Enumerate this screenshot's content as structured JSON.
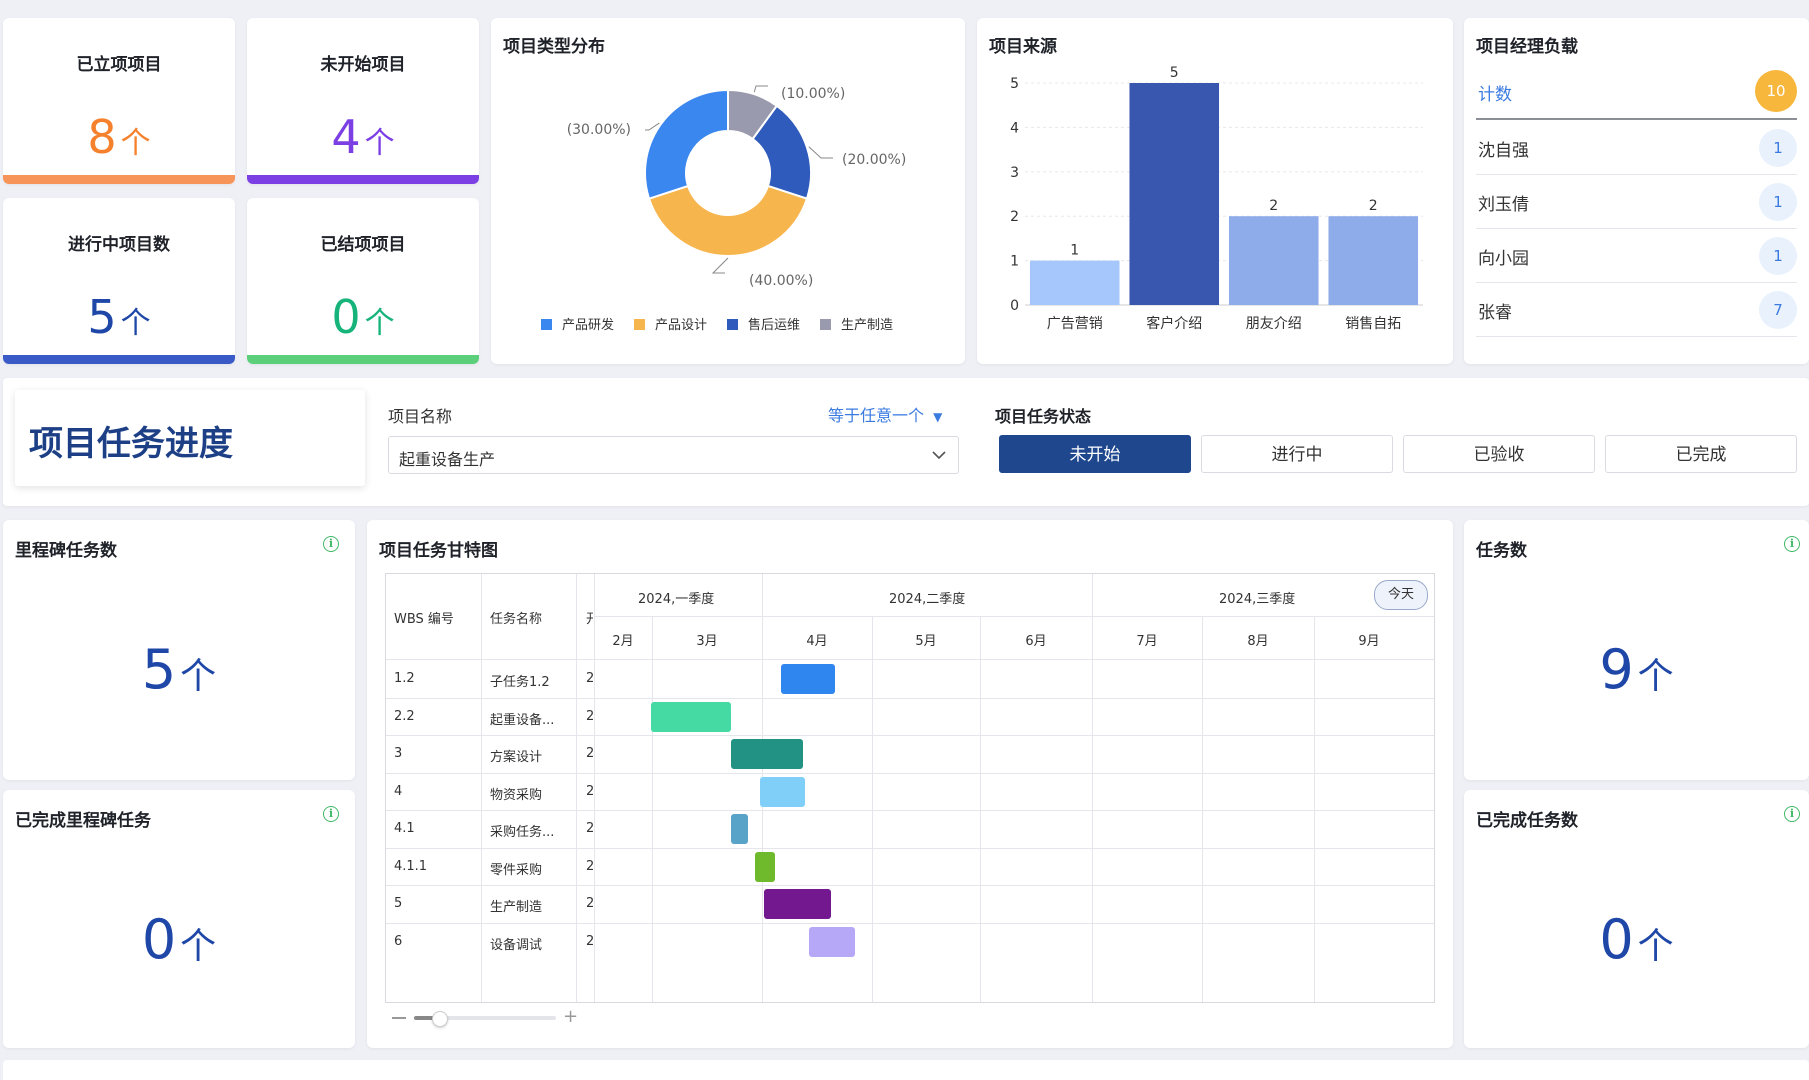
{
  "stats": [
    {
      "title": "已立项项目",
      "value": "8",
      "unit": "个",
      "color": "#f5812d",
      "bar": "#f6945a"
    },
    {
      "title": "未开始项目",
      "value": "4",
      "unit": "个",
      "color": "#7b3fe4",
      "bar": "#7b3fe4"
    },
    {
      "title": "进行中项目数",
      "value": "5",
      "unit": "个",
      "color": "#1e47a8",
      "bar": "#3a5bc7"
    },
    {
      "title": "已结项项目",
      "value": "0",
      "unit": "个",
      "color": "#16b37a",
      "bar": "#5ccf7a"
    }
  ],
  "type_dist": {
    "title": "项目类型分布",
    "chart_data": {
      "type": "pie",
      "labels": [
        "产品研发",
        "产品设计",
        "售后运维",
        "生产制造"
      ],
      "values": [
        30,
        40,
        20,
        10
      ],
      "value_labels": [
        "(30.00%)",
        "(40.00%)",
        "(20.00%)",
        "(10.00%)"
      ],
      "colors": [
        "#3b87f0",
        "#f7b54d",
        "#2f5bbd",
        "#9a9aae"
      ]
    }
  },
  "source": {
    "title": "项目来源",
    "chart_data": {
      "type": "bar",
      "categories": [
        "广告营销",
        "客户介绍",
        "朋友介绍",
        "销售自拓"
      ],
      "values": [
        1,
        5,
        2,
        2
      ],
      "ylim": [
        0,
        5
      ],
      "yticks": [
        "0",
        "1",
        "2",
        "3",
        "4",
        "5"
      ],
      "colors": [
        "#a6c7fb",
        "#3a57b0",
        "#8eabea",
        "#8eabea"
      ]
    }
  },
  "managers": {
    "title": "项目经理负载",
    "header_label": "计数",
    "header_value": "10",
    "rows": [
      {
        "name": "沈自强",
        "count": "1"
      },
      {
        "name": "刘玉倩",
        "count": "1"
      },
      {
        "name": "向小园",
        "count": "1"
      },
      {
        "name": "张睿",
        "count": "7"
      }
    ]
  },
  "filter": {
    "page_title": "项目任务进度",
    "project_label": "项目名称",
    "operator": "等于任意一个",
    "project_value": "起重设备生产",
    "status_label": "项目任务状态",
    "status_options": [
      "未开始",
      "进行中",
      "已验收",
      "已完成"
    ],
    "active_status": "未开始"
  },
  "kpis": {
    "milestone_title": "里程碑任务数",
    "milestone_value": "5",
    "milestone_done_title": "已完成里程碑任务",
    "milestone_done_value": "0",
    "task_title": "任务数",
    "task_value": "9",
    "task_done_title": "已完成任务数",
    "task_done_value": "0",
    "unit": "个"
  },
  "gantt": {
    "title": "项目任务甘特图",
    "col_wbs": "WBS 编号",
    "col_name": "任务名称",
    "col_start_partial": "开",
    "today_label": "今天",
    "quarters": [
      "2024,一季度",
      "2024,二季度",
      "2024,三季度"
    ],
    "months": [
      "2月",
      "3月",
      "4月",
      "5月",
      "6月",
      "7月",
      "8月",
      "9月"
    ],
    "rows": [
      {
        "wbs": "1.2",
        "name": "子任务1.2",
        "start": "2",
        "color": "#2f86ee",
        "from": 4.17,
        "to": 4.66
      },
      {
        "wbs": "2.2",
        "name": "起重设备...",
        "start": "2",
        "color": "#45d9a3",
        "from": 2.98,
        "to": 3.72
      },
      {
        "wbs": "3",
        "name": "方案设计",
        "start": "2",
        "color": "#219283",
        "from": 3.72,
        "to": 4.37
      },
      {
        "wbs": "4",
        "name": "物资采购",
        "start": "2",
        "color": "#7fcff8",
        "from": 3.98,
        "to": 4.39
      },
      {
        "wbs": "4.1",
        "name": "采购任务...",
        "start": "2",
        "color": "#5aa3c8",
        "from": 3.72,
        "to": 3.87
      },
      {
        "wbs": "4.1.1",
        "name": "零件采购",
        "start": "2",
        "color": "#6fba2c",
        "from": 3.94,
        "to": 4.12
      },
      {
        "wbs": "5",
        "name": "生产制造",
        "start": "2",
        "color": "#741890",
        "from": 4.02,
        "to": 4.63
      },
      {
        "wbs": "6",
        "name": "设备调试",
        "start": "2",
        "color": "#b7a8f7",
        "from": 4.43,
        "to": 4.85
      }
    ]
  }
}
